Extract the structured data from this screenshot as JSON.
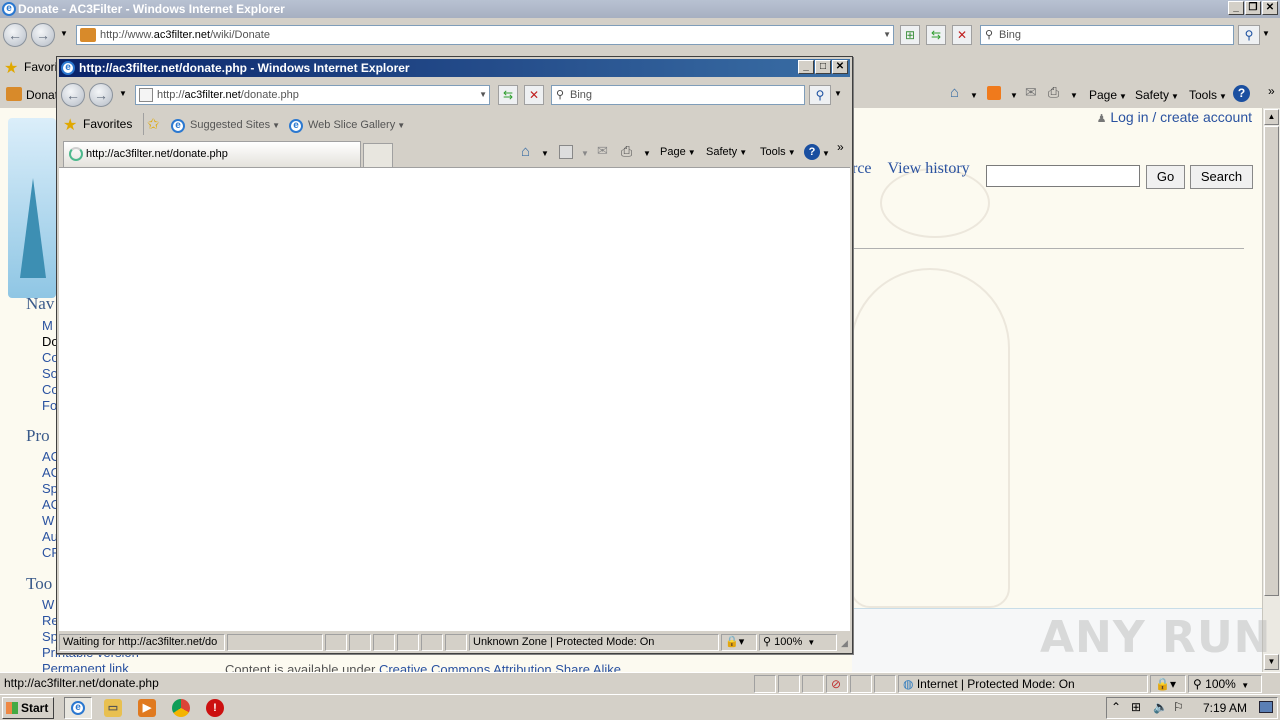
{
  "outer": {
    "title": "Donate - AC3Filter - Windows Internet Explorer",
    "address_prefix": "http://www.",
    "address_host": "ac3filter.net",
    "address_path": "/wiki/Donate",
    "search_placeholder": "Bing",
    "favorites_label": "Favori",
    "tab_label": "Donat",
    "commands": {
      "page": "Page",
      "safety": "Safety",
      "tools": "Tools"
    }
  },
  "wiki": {
    "login": "Log in / create account",
    "view_history": "View history",
    "tab_fragment": "rce",
    "go": "Go",
    "search": "Search",
    "sidebar": [
      {
        "heading": "Nav",
        "items": [
          "M",
          "Do",
          "Co",
          "So",
          "Co",
          "Fo"
        ]
      },
      {
        "heading": "Pro",
        "items": [
          "AC",
          "AC",
          "Sp",
          "AC",
          "W",
          "Au",
          "CF"
        ]
      },
      {
        "heading": "Too",
        "items": [
          "W",
          "Re",
          "Sp",
          "Printable version",
          "Permanent link"
        ]
      }
    ],
    "footer_text": "Content is available under ",
    "footer_link": "Creative Commons Attribution Share Alike"
  },
  "popup": {
    "title": "http://ac3filter.net/donate.php - Windows Internet Explorer",
    "address_prefix": "http://",
    "address_host": "ac3filter.net",
    "address_path": "/donate.php",
    "search_placeholder": "Bing",
    "favorites": "Favorites",
    "suggested_sites": "Suggested Sites",
    "web_slice_gallery": "Web Slice Gallery",
    "tab_label": "http://ac3filter.net/donate.php",
    "commands": {
      "page": "Page",
      "safety": "Safety",
      "tools": "Tools"
    },
    "status_text": "Waiting for http://ac3filter.net/do",
    "zone": "Unknown Zone | Protected Mode: On",
    "zoom": "100%"
  },
  "outer_status": {
    "url": "http://ac3filter.net/donate.php",
    "zone": "Internet | Protected Mode: On",
    "zoom": "100%"
  },
  "taskbar": {
    "start": "Start",
    "clock": "7:19 AM"
  },
  "watermark": "ANY RUN"
}
